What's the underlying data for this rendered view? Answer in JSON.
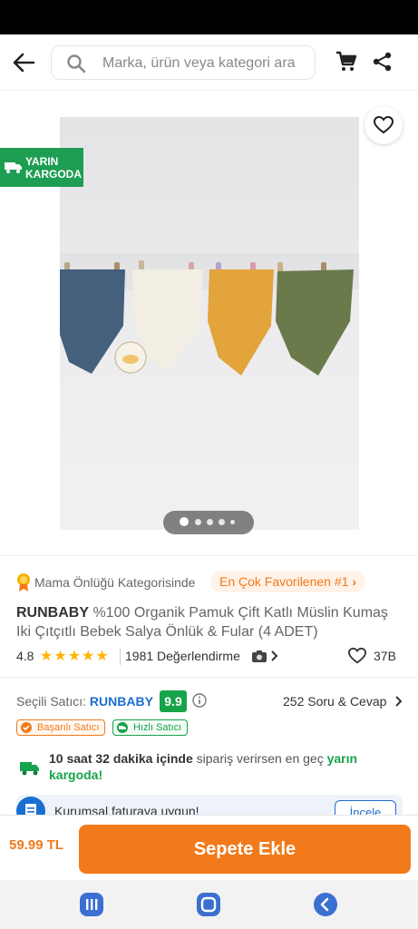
{
  "search": {
    "placeholder": "Marka, ürün veya kategori ara"
  },
  "gallery": {
    "badge_line1": "YARIN",
    "badge_line2": "KARGODA",
    "image_count": 5,
    "active_image": 1,
    "brand_color": "#f27a1a"
  },
  "product": {
    "category_text": "Mama Önlüğü Kategorisinde",
    "favorites_tag": "En Çok Favorilenen #1",
    "brand": "RUNBABY",
    "title": "%100 Organik Pamuk Çift Katlı Müslin Kumaş Iki Çıtçıtlı Bebek Salya Önlük & Fular (4 ADET)",
    "rating": "4.8",
    "stars": "★★★★★",
    "reviews": "1981 Değerlendirme",
    "likes": "37B"
  },
  "seller": {
    "label": "Seçili Satıcı:",
    "name": "RUNBABY",
    "score": "9.9",
    "qa": "252 Soru & Cevap",
    "badge1": "Başarılı Satıcı",
    "badge2": "Hızlı Satıcı"
  },
  "shipping": {
    "bold": "10 saat 32 dakika içinde",
    "mid": " sipariş verirsen en geç ",
    "green": "yarın kargoda!"
  },
  "invoice": {
    "text": "Kurumsal faturaya uygun!",
    "button": "İncele"
  },
  "cart": {
    "price": "59.99 TL",
    "button": "Sepete Ekle"
  }
}
